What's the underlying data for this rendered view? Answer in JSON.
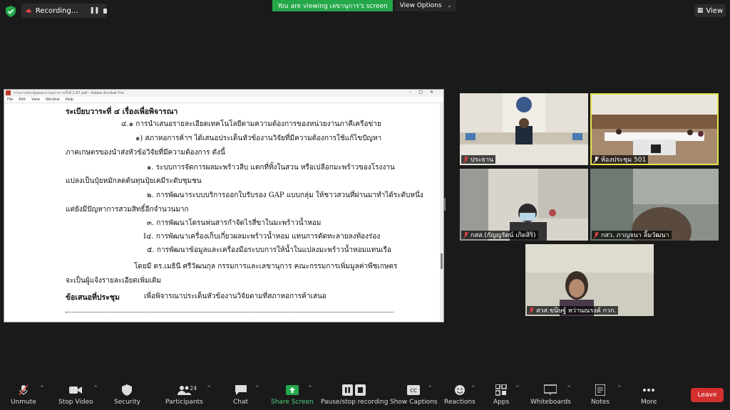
{
  "top": {
    "recording_label": "Recording...",
    "viewing_banner": "You are viewing เลขานุการ's screen",
    "view_options_label": "View Options",
    "view_button_label": "View"
  },
  "window": {
    "title": "วาระการประชุมคณะกรรมการฯ ครั้งที่ 1-67.pdf - Adobe Acrobat Pro",
    "menu": [
      "File",
      "Edit",
      "View",
      "Window",
      "Help"
    ]
  },
  "document": {
    "lines": [
      "ระเบียบวาระที่ ๔ เรื่องเพื่อพิจารณา",
      "๔.๑ การนำเสนอรายละเอียดเทคโนโลยีตามความต้องการของหน่วยงานภาคีเครือข่าย",
      "๑) สภาหอการค้าฯ ได้เสนอประเด็นหัวข้องานวิจัยที่มีความต้องการใช้แก้ไขปัญหา",
      "ภาคเกษตรของนำส่งหัวข้อวิจัยที่มีความต้องการ ดังนี้",
      "๑. ระบบการจัดการผลมะพร้าวลีบ แตกที่ทิ้งในสวน หรือเปลือกมะพร้าวของโรงงาน",
      "แปลงเป็นปุ๋ยหมักลดต้นทุนปุ๋ยเคมีระดับชุมชน",
      "๒. การพัฒนาระบบบริการออกใบรับรอง GAP แบบกลุ่ม ให้ชาวสวนที่ผ่านมาทำได้ระดับหนึ่ง",
      "แต่ยังมีปัญหาการสวมสิทธิ์อีกจำนวนมาก",
      "๓. การพัฒนาโดรนพ่นสารกำจัดไรสี่ขาในมะพร้าวน้ำหอม",
      "I๔. การพัฒนาเครื่องเก็บเกี่ยวผลมะพร้าวน้ำหอม แทนการตัดทะลายลงท้องร่อง",
      "๕. การพัฒนาข้อมูลและเครื่องมือระบบการให้น้ำในแปลงมะพร้าวน้ำหอมแทนเรือ",
      "โดยมี ดร.เมธินี ศรีวัฒนกุล กรรมการและเลขานุการ คณะกรรมการเพิ่มมูลค่าพืชเกษตร",
      "จะเป็นผู้แจ้งรายละเอียดเพิ่มเติม",
      "ข้อเสนอที่ประชุม",
      "เพื่อพิจารณาประเด็นหัวข้องานวิจัยตามที่สภาหอการค้าเสนอ"
    ]
  },
  "tiles": [
    {
      "name": "ประธาน"
    },
    {
      "name": "ห้องประชุม 501"
    },
    {
      "name": "กสส.(กัญญรัตน์ เกิดสิริ)"
    },
    {
      "name": "กสว. ภาญจนา ลิ้มวัฒนา"
    },
    {
      "name": "สวส.ขนิษฐ์ หว่านณรงค์ กวก."
    }
  ],
  "toolbar": {
    "unmute": "Unmute",
    "stop_video": "Stop Video",
    "security": "Security",
    "participants": "Participants",
    "participants_count": "24",
    "chat": "Chat",
    "share_screen": "Share Screen",
    "pause_recording": "Pause/stop recording",
    "captions": "Show Captions",
    "reactions": "Reactions",
    "apps": "Apps",
    "whiteboards": "Whiteboards",
    "notes": "Notes",
    "more": "More",
    "leave": "Leave"
  },
  "colors": {
    "share_green": "#24a84a",
    "leave_red": "#d42f2f",
    "active_speaker": "#e9e24f"
  }
}
